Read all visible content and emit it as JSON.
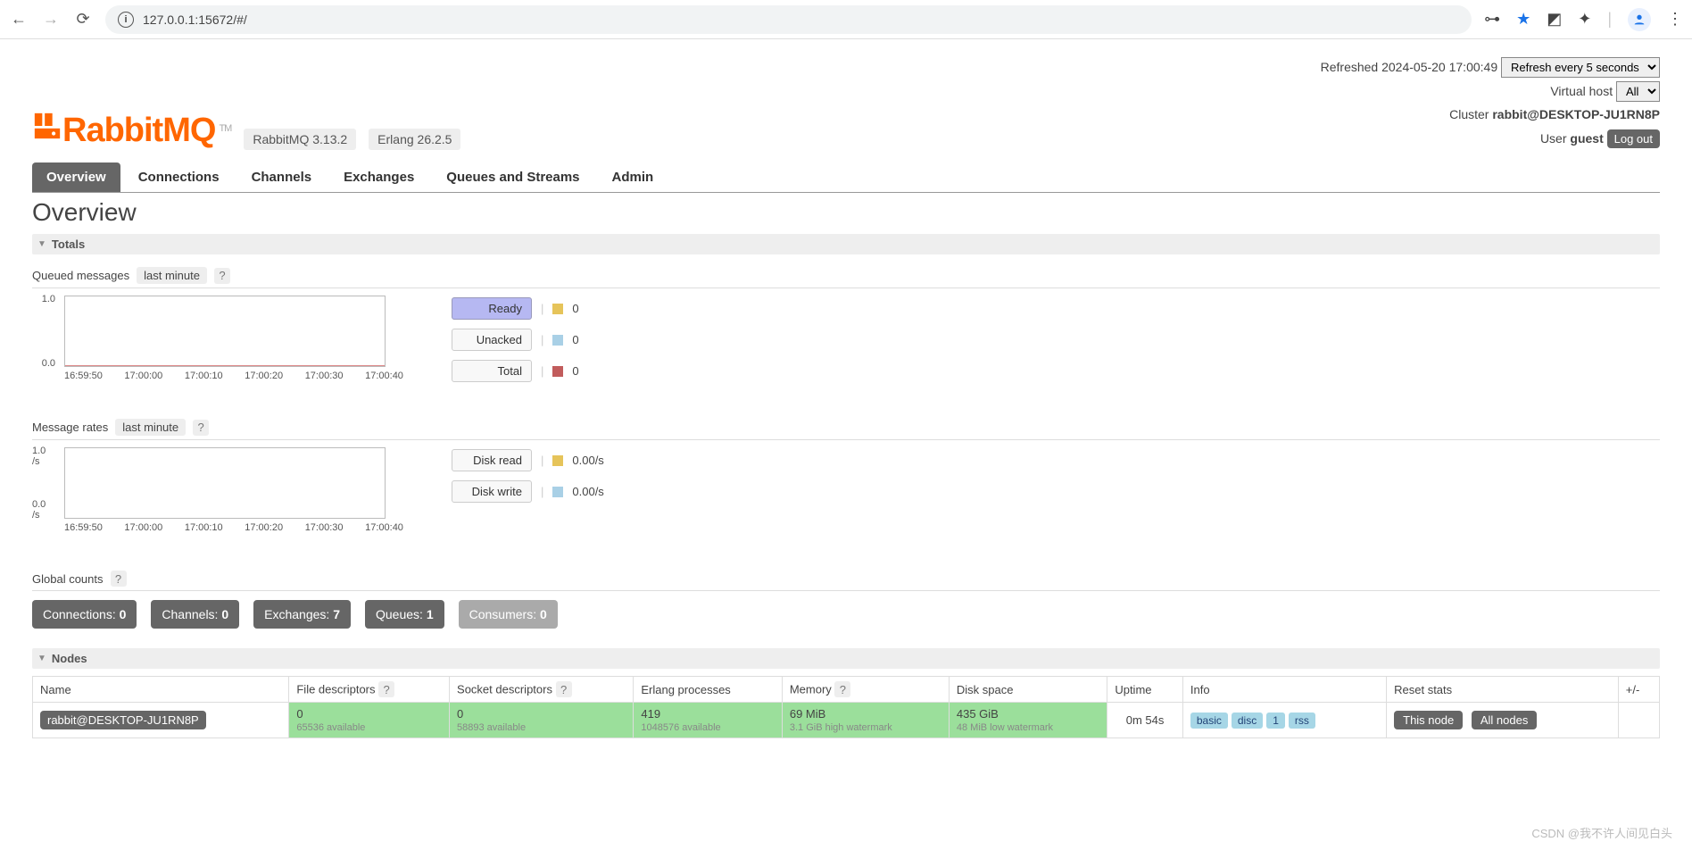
{
  "browser": {
    "url": "127.0.0.1:15672/#/"
  },
  "header": {
    "logo_text": "RabbitMQ",
    "tm": "TM",
    "version_rabbit": "RabbitMQ 3.13.2",
    "version_erlang": "Erlang 26.2.5",
    "refreshed_label": "Refreshed 2024-05-20 17:00:49",
    "refresh_select": "Refresh every 5 seconds",
    "vhost_label": "Virtual host",
    "vhost_select": "All",
    "cluster_label": "Cluster",
    "cluster_name": "rabbit@DESKTOP-JU1RN8P",
    "user_label": "User",
    "user_name": "guest",
    "logout": "Log out"
  },
  "tabs": [
    "Overview",
    "Connections",
    "Channels",
    "Exchanges",
    "Queues and Streams",
    "Admin"
  ],
  "page_title": "Overview",
  "sections": {
    "totals": "Totals",
    "nodes": "Nodes"
  },
  "totals": {
    "queued_label": "Queued messages",
    "queued_period": "last minute",
    "rates_label": "Message rates",
    "rates_period": "last minute",
    "global_label": "Global counts"
  },
  "chart_data": [
    {
      "type": "line",
      "title": "Queued messages",
      "x_ticks": [
        "16:59:50",
        "17:00:00",
        "17:00:10",
        "17:00:20",
        "17:00:30",
        "17:00:40"
      ],
      "ylim": [
        0,
        1.0
      ],
      "y_ticks": [
        "1.0",
        "0.0"
      ],
      "series": [
        {
          "name": "Ready",
          "values": [
            0,
            0,
            0,
            0,
            0,
            0
          ],
          "color": "#e6c45a"
        },
        {
          "name": "Unacked",
          "values": [
            0,
            0,
            0,
            0,
            0,
            0
          ],
          "color": "#a9d0e6"
        },
        {
          "name": "Total",
          "values": [
            0,
            0,
            0,
            0,
            0,
            0
          ],
          "color": "#c15c5c"
        }
      ],
      "legend": [
        {
          "label": "Ready",
          "value": "0",
          "color": "#e6c45a",
          "highlight": true
        },
        {
          "label": "Unacked",
          "value": "0",
          "color": "#a9d0e6"
        },
        {
          "label": "Total",
          "value": "0",
          "color": "#c15c5c"
        }
      ]
    },
    {
      "type": "line",
      "title": "Message rates",
      "x_ticks": [
        "16:59:50",
        "17:00:00",
        "17:00:10",
        "17:00:20",
        "17:00:30",
        "17:00:40"
      ],
      "ylim": [
        0,
        1.0
      ],
      "y_ticks": [
        "1.0 /s",
        "0.0 /s"
      ],
      "series": [
        {
          "name": "Disk read",
          "values": [
            0,
            0,
            0,
            0,
            0,
            0
          ],
          "color": "#e6c45a"
        },
        {
          "name": "Disk write",
          "values": [
            0,
            0,
            0,
            0,
            0,
            0
          ],
          "color": "#a9d0e6"
        }
      ],
      "legend": [
        {
          "label": "Disk read",
          "value": "0.00/s",
          "color": "#e6c45a"
        },
        {
          "label": "Disk write",
          "value": "0.00/s",
          "color": "#a9d0e6"
        }
      ]
    }
  ],
  "global_counts": [
    {
      "label": "Connections:",
      "value": "0",
      "disabled": false
    },
    {
      "label": "Channels:",
      "value": "0",
      "disabled": false
    },
    {
      "label": "Exchanges:",
      "value": "7",
      "disabled": false
    },
    {
      "label": "Queues:",
      "value": "1",
      "disabled": false
    },
    {
      "label": "Consumers:",
      "value": "0",
      "disabled": true
    }
  ],
  "nodes": {
    "headers": [
      "Name",
      "File descriptors",
      "Socket descriptors",
      "Erlang processes",
      "Memory",
      "Disk space",
      "Uptime",
      "Info",
      "Reset stats",
      "+/-"
    ],
    "row": {
      "name": "rabbit@DESKTOP-JU1RN8P",
      "fd": "0",
      "fd_note": "65536 available",
      "sd": "0",
      "sd_note": "58893 available",
      "ep": "419",
      "ep_note": "1048576 available",
      "mem": "69 MiB",
      "mem_note": "3.1 GiB high watermark",
      "disk": "435 GiB",
      "disk_note": "48 MiB low watermark",
      "uptime": "0m 54s",
      "info": [
        "basic",
        "disc",
        "1",
        "rss"
      ],
      "reset_this": "This node",
      "reset_all": "All nodes"
    }
  },
  "watermark": "CSDN @我不许人间见白头"
}
